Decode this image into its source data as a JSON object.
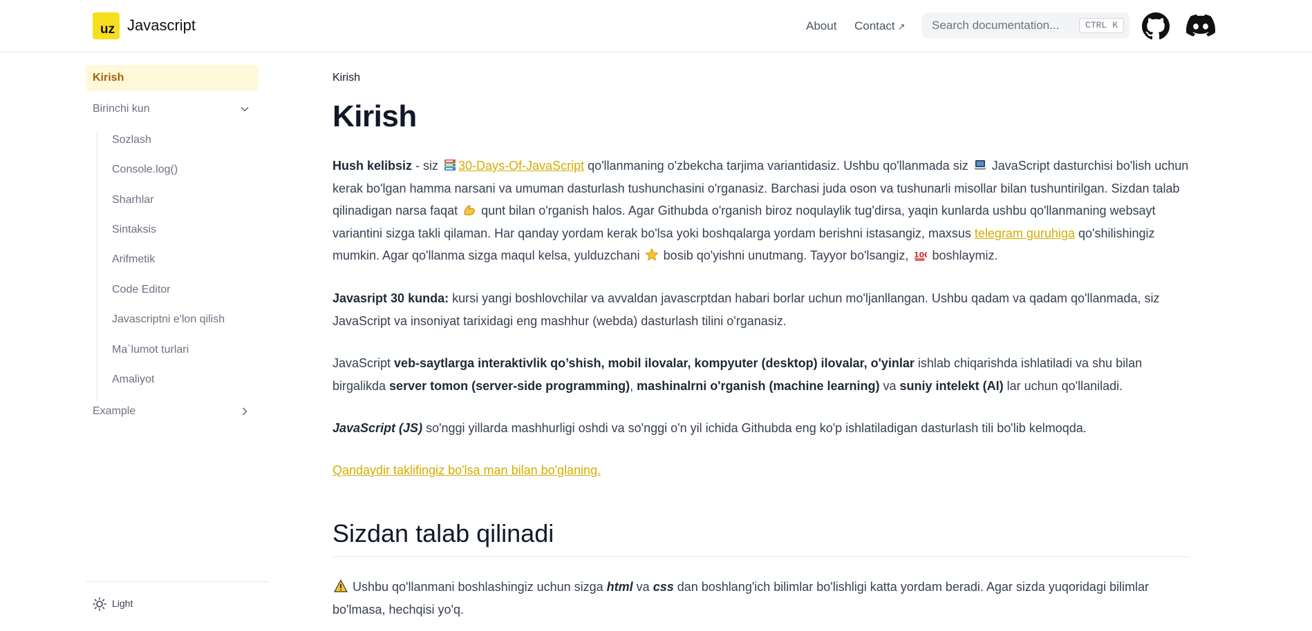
{
  "header": {
    "logo_badge": "uz",
    "logo_text": "Javascript",
    "nav_about": "About",
    "nav_contact": "Contact",
    "nav_contact_arrow": "↗",
    "search_placeholder": "Search documentation...",
    "kbd_ctrl": "CTRL",
    "kbd_k": "K",
    "icons": [
      "github-icon",
      "discord-icon"
    ]
  },
  "sidebar": {
    "active": "Kirish",
    "section_day1": "Birinchi kun",
    "children": [
      "Sozlash",
      "Console.log()",
      "Sharhlar",
      "Sintaksis",
      "Arifmetik",
      "Code Editor",
      "Javascriptni e'lon qilish",
      "Ma`lumot turlari",
      "Amaliyot"
    ],
    "section_example": "Example",
    "theme_label": "Light"
  },
  "main": {
    "breadcrumb": "Kirish",
    "title": "Kirish",
    "p1": {
      "bold_start": "Hush kelibsiz",
      "t1": " - siz ",
      "link1": "30-Days-Of-JavaScript",
      "t2": " qo'llanmaning o'zbekcha tarjima variantidasiz. Ushbu qo'llanmada siz ",
      "t3": " JavaScript dasturchisi bo'lish uchun kerak bo'lgan hamma narsani va umuman dasturlash tushunchasini o'rganasiz. Barchasi juda oson va tushunarli misollar bilan tushuntirilgan. Sizdan talab qilinadigan narsa faqat ",
      "t4": " qunt bilan o'rganish halos. Agar Githubda o'rganish biroz noqulaylik tug'dirsa, yaqin kunlarda ushbu qo'llanmaning websayt variantini sizga takli qilaman. Har qanday yordam kerak bo'lsa yoki boshqalarga yordam berishni istasangiz, maxsus ",
      "link2": "telegram guruhiga",
      "t5": " qo'shilishingiz mumkin. Agar qo'llanma sizga maqul kelsa, yulduzchani ",
      "t6": " bosib qo'yishni unutmang. Tayyor bo'lsangiz, ",
      "t7": " boshlaymiz."
    },
    "p2": {
      "bold": "Javasript 30 kunda:",
      "text": " kursi yangi boshlovchilar va avvaldan javascrptdan habari borlar uchun mo'ljanllangan. Ushbu qadam va qadam qo'llanmada, siz JavaScript va insoniyat tarixidagi eng mashhur (webda) dasturlash tilini o'rganasiz."
    },
    "p3": {
      "t1": "JavaScript ",
      "b1": "veb-saytlarga interaktivlik qo’shish, mobil ilovalar, kompyuter (desktop) ilovalar, o'yinlar",
      "t2": " ishlab chiqarishda ishlatiladi va shu bilan birgalikda ",
      "b2": "server tomon (server-side programming)",
      "t3": ", ",
      "b3": "mashinalrni o'rganish (machine learning)",
      "t4": " va ",
      "b4": "suniy intelekt (AI)",
      "t5": " lar uchun qo'llaniladi."
    },
    "p4": {
      "bi": "JavaScript (JS)",
      "text": " so'nggi yillarda mashhurligi oshdi va so'nggi o'n yil ichida Githubda eng ko'p ishlatiladigan dasturlash tili bo'lib kelmoqda."
    },
    "contact_link": "Qandaydir taklifingiz bo'lsa man bilan bo'glaning.",
    "h2": "Sizdan talab qilinadi",
    "p5": {
      "t1": " Ushbu qo'llanmani boshlashingiz uchun sizga ",
      "html": "html",
      "t2": " va ",
      "css": "css",
      "t3": " dan boshlang'ich bilimlar bo'lishligi katta yordam beradi. Agar sizda yuqoridagi bilimlar bo'lmasa, hechqisi yo'q."
    }
  },
  "colors": {
    "brand": "#f7df1e",
    "link": "#d4ad00",
    "active_bg": "#fff8db",
    "active_text": "#a16207"
  }
}
